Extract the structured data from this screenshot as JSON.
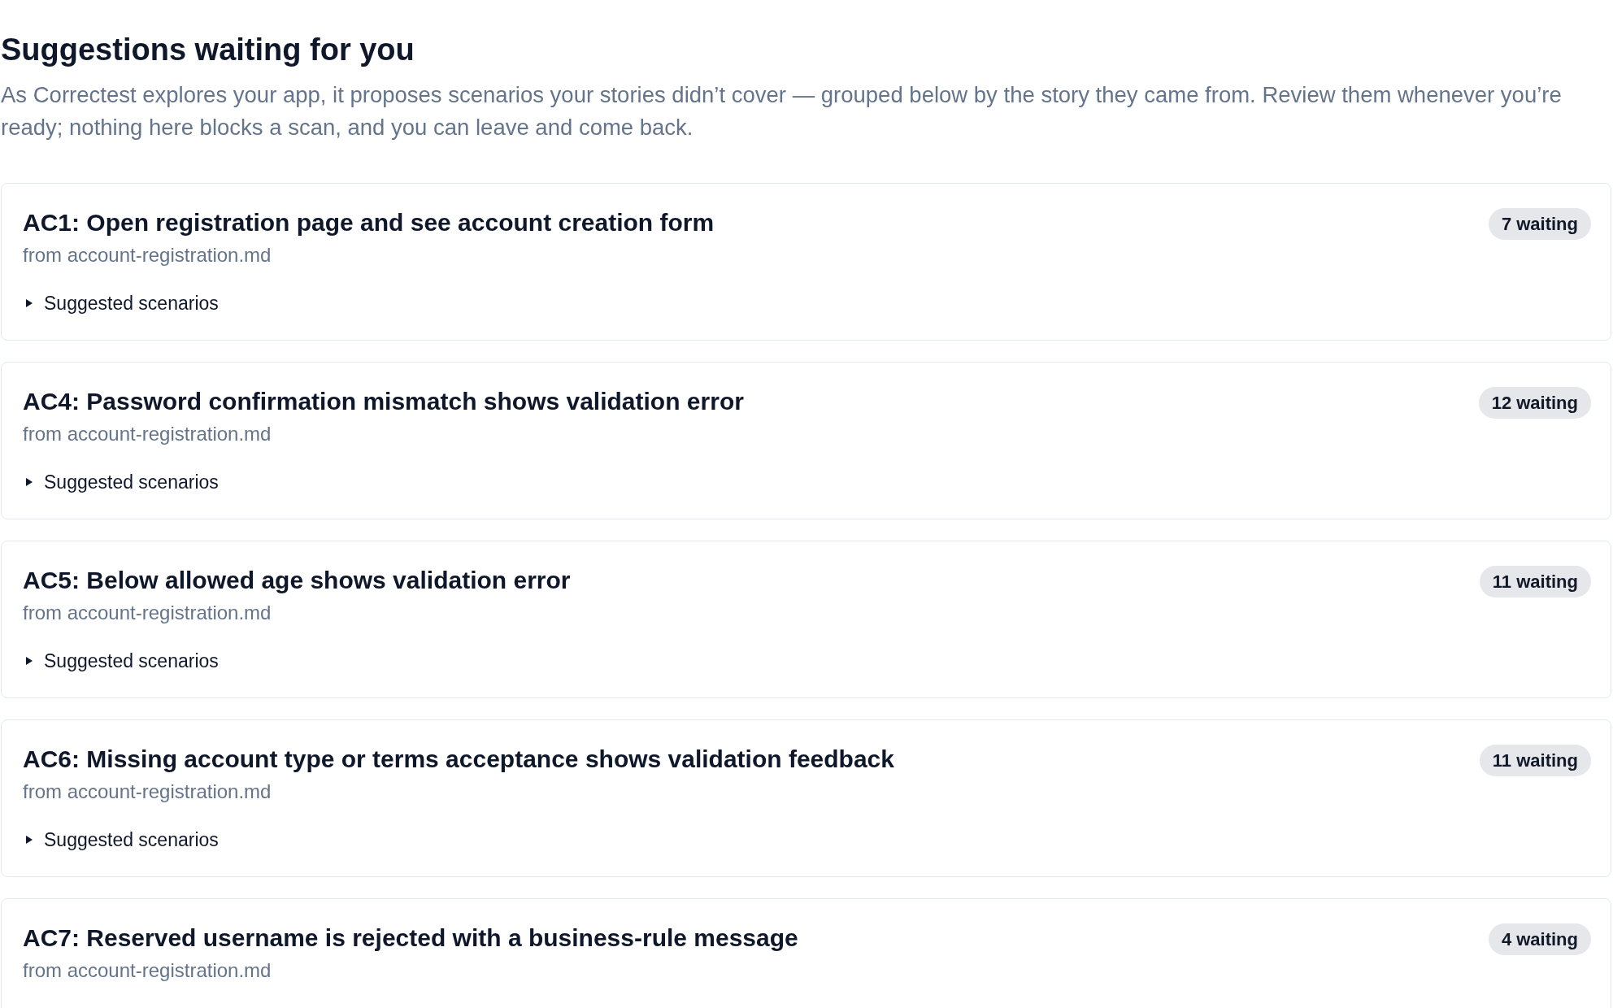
{
  "header": {
    "title": "Suggestions waiting for you",
    "description": "As Correctest explores your app, it proposes scenarios your stories didn’t cover — grouped below by the story they came from. Review them whenever you’re ready; nothing here blocks a scan, and you can leave and come back."
  },
  "stories": [
    {
      "title": "AC1: Open registration page and see account creation form",
      "source": "from account-registration.md",
      "badge": "7 waiting",
      "scenarios": {
        "label": "Suggested scenarios",
        "expanded": false
      }
    },
    {
      "title": "AC4: Password confirmation mismatch shows validation error",
      "source": "from account-registration.md",
      "badge": "12 waiting",
      "scenarios": {
        "label": "Suggested scenarios",
        "expanded": false
      }
    },
    {
      "title": "AC5: Below allowed age shows validation error",
      "source": "from account-registration.md",
      "badge": "11 waiting",
      "scenarios": {
        "label": "Suggested scenarios",
        "expanded": false
      }
    },
    {
      "title": "AC6: Missing account type or terms acceptance shows validation feedback",
      "source": "from account-registration.md",
      "badge": "11 waiting",
      "scenarios": {
        "label": "Suggested scenarios",
        "expanded": false
      }
    },
    {
      "title": "AC7: Reserved username is rejected with a business-rule message",
      "source": "from account-registration.md",
      "badge": "4 waiting"
    }
  ]
}
